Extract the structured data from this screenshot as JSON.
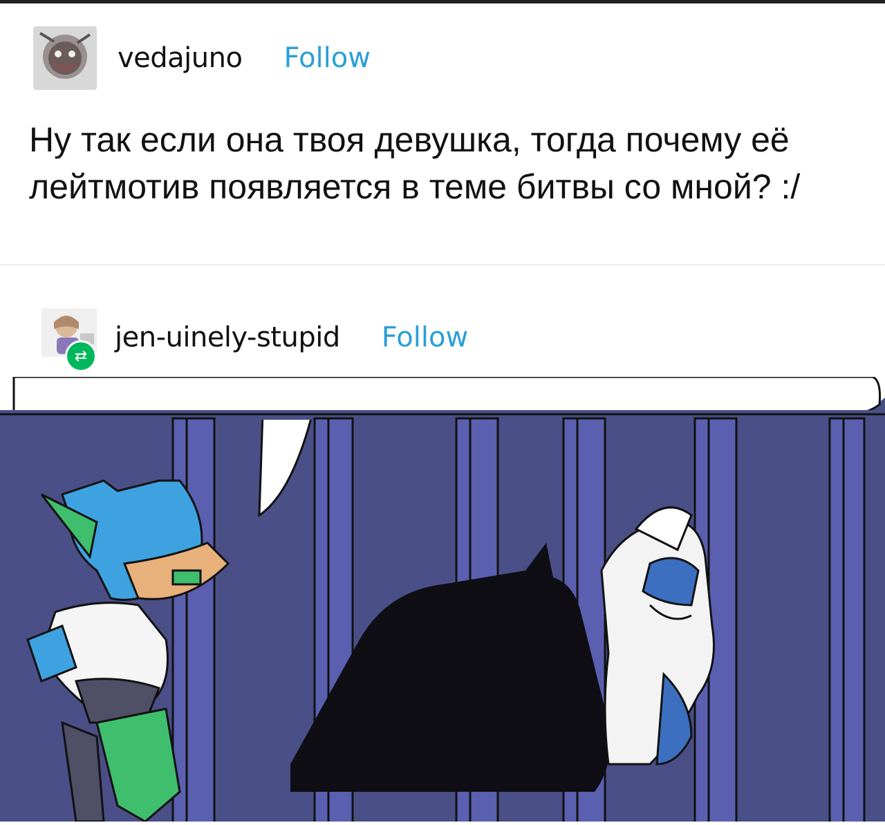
{
  "posts": [
    {
      "username": "vedajuno",
      "follow_label": "Follow",
      "text": "Ну так если она твоя девушка, тогда почему её лейтмотив появляется в теме битвы со мной? :/"
    },
    {
      "username": "jen-uinely-stupid",
      "follow_label": "Follow",
      "reblog_icon": "reblog-icon"
    }
  ],
  "colors": {
    "follow": "#2a9fd8",
    "reblog_badge": "#00b85c",
    "comic_background": "#4a4f87",
    "cage_bars": "#5a5fb0"
  }
}
